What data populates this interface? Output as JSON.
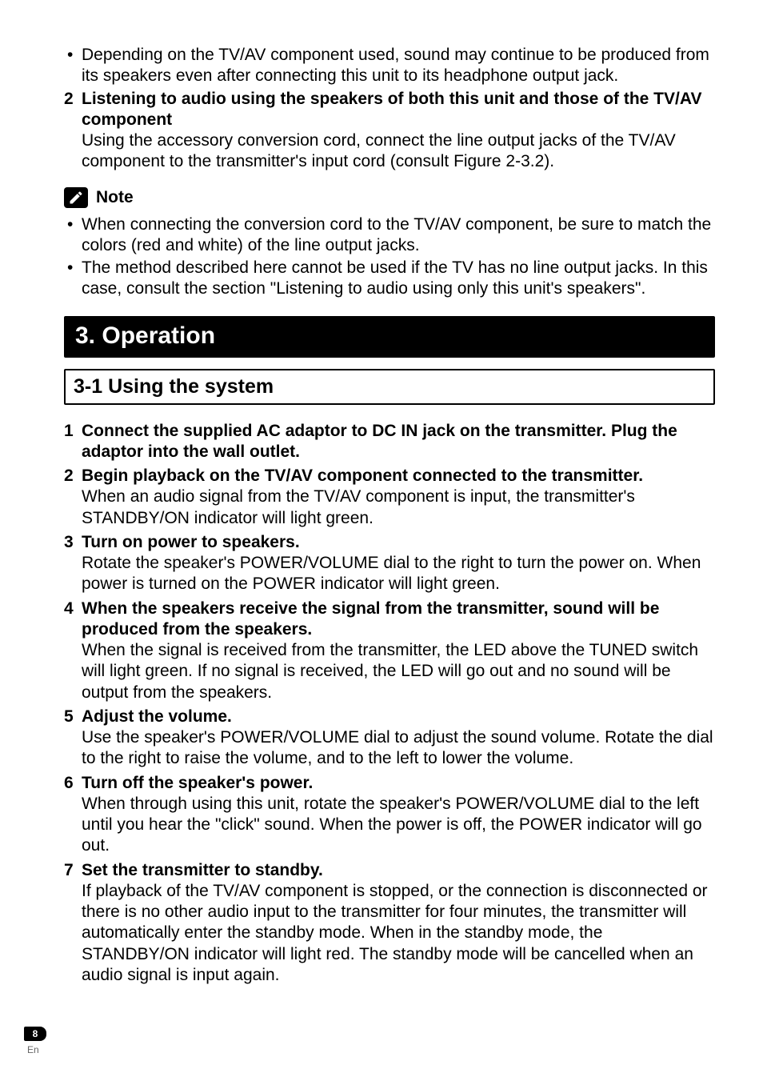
{
  "top_bullet": "Depending on the TV/AV component used, sound may continue to be produced from its speakers even after connecting this unit to its headphone output jack.",
  "item2": {
    "num": "2",
    "title": "Listening to audio using the speakers of both this unit and those of the TV/AV component",
    "body": "Using the accessory conversion cord, connect the line output jacks of the TV/AV component to the transmitter's input cord (consult Figure 2-3.2)."
  },
  "note_label": "Note",
  "note_bullets": [
    "When connecting the conversion cord to the TV/AV component, be sure to match the colors (red and white) of the line output jacks.",
    "The method described here cannot be used if the TV has no line output jacks. In this case, consult the section \"Listening to audio using only this unit's speakers\"."
  ],
  "chapter": "3. Operation",
  "section": "3-1 Using the system",
  "steps": [
    {
      "num": "1",
      "title": "Connect the supplied AC adaptor to DC IN jack on the transmitter. Plug the adaptor into the wall outlet.",
      "body": ""
    },
    {
      "num": "2",
      "title": "Begin playback on the TV/AV component connected to the transmitter.",
      "body": "When an audio signal from the TV/AV component is input, the transmitter's STANDBY/ON indicator will light green."
    },
    {
      "num": "3",
      "title": "Turn on power to speakers.",
      "body": "Rotate the speaker's POWER/VOLUME dial to the right to turn the power on. When power is turned on the POWER indicator will light green."
    },
    {
      "num": "4",
      "title": "When the speakers receive the signal from the transmitter, sound will be produced from the speakers.",
      "body": "When the signal is received from the transmitter, the LED above the TUNED switch will light green. If no signal is received, the LED will go out and no sound will be output from the speakers."
    },
    {
      "num": "5",
      "title": "Adjust the volume.",
      "body": "Use the speaker's POWER/VOLUME dial to adjust the sound volume. Rotate the dial to the right to raise the volume, and to the left to lower the volume."
    },
    {
      "num": "6",
      "title": "Turn off the speaker's power.",
      "body": "When through using this unit, rotate the speaker's POWER/VOLUME dial to the left until you hear the \"click\" sound. When the power is off, the POWER indicator will go out."
    },
    {
      "num": "7",
      "title": "Set the transmitter to standby.",
      "body": "If playback of the TV/AV component is stopped, or the connection is disconnected or there is no other audio input to the transmitter for four minutes, the transmitter will automatically enter the standby mode. When in the standby mode, the STANDBY/ON indicator will light red. The standby mode will be cancelled when an audio signal is input again."
    }
  ],
  "page_number": "8",
  "lang": "En"
}
